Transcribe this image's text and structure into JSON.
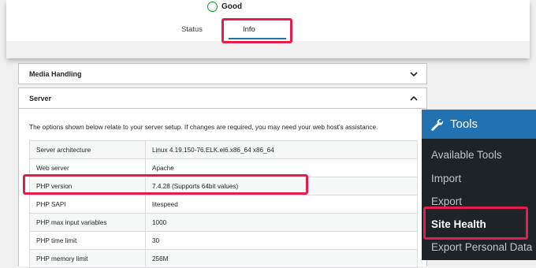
{
  "status": {
    "label": "Good",
    "color": "#00a32a"
  },
  "tabs": [
    {
      "label": "Status"
    },
    {
      "label": "Info",
      "active": true
    }
  ],
  "sections": {
    "media": {
      "title": "Media Handling",
      "expanded": false
    },
    "server": {
      "title": "Server",
      "expanded": true,
      "description": "The options shown below relate to your server setup. If changes are required, you may need your web host's assistance."
    }
  },
  "server_table": {
    "rows": [
      {
        "key": "Server architecture",
        "value": "Linux 4.19.150-76.ELK.el6.x86_64 x86_64"
      },
      {
        "key": "Web server",
        "value": "Apache"
      },
      {
        "key": "PHP version",
        "value": "7.4.28 (Supports 64bit values)"
      },
      {
        "key": "PHP SAPI",
        "value": "litespeed"
      },
      {
        "key": "PHP max input variables",
        "value": "1000"
      },
      {
        "key": "PHP time limit",
        "value": "30"
      },
      {
        "key": "PHP memory limit",
        "value": "256M"
      }
    ]
  },
  "admin_menu": {
    "title": "Tools",
    "icon": "wrench-icon",
    "items": [
      {
        "label": "Available Tools"
      },
      {
        "label": "Import"
      },
      {
        "label": "Export"
      },
      {
        "label": "Site Health",
        "active": true
      },
      {
        "label": "Export Personal Data"
      }
    ]
  },
  "colors": {
    "highlight": "#e01e4f",
    "accent": "#2271b1",
    "menu_bg": "#1d2327"
  }
}
